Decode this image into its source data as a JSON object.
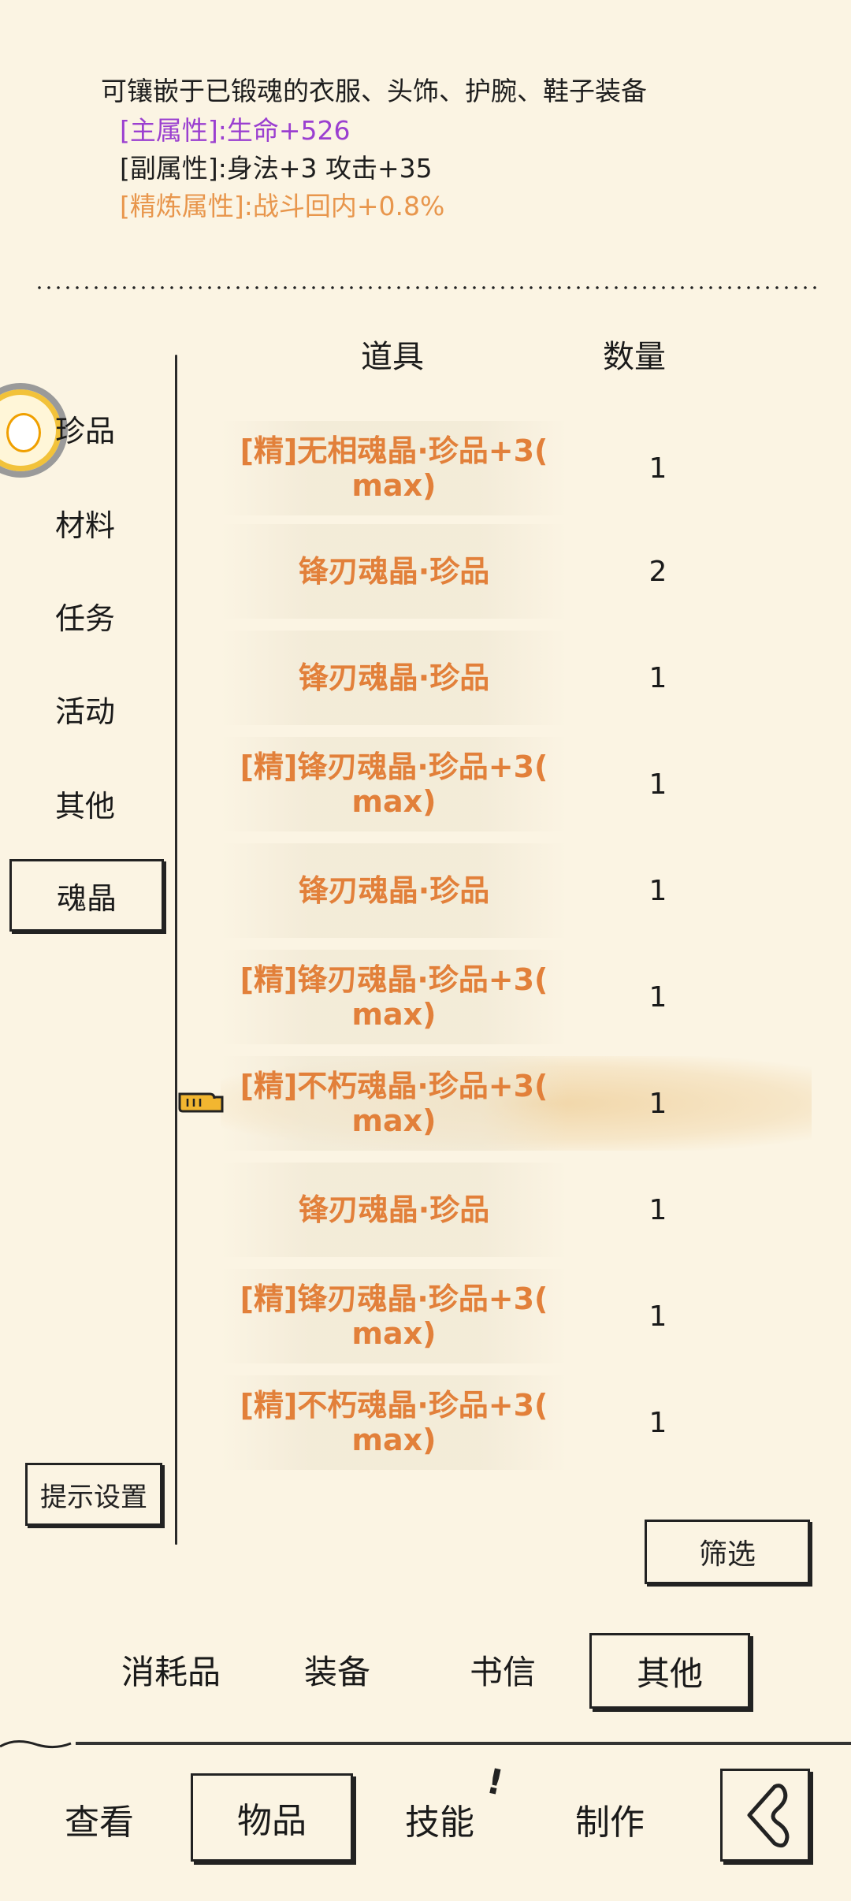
{
  "description": {
    "text": "可镶嵌于已锻魂的衣服、头饰、护腕、鞋子装备",
    "main_attr_label": "[主属性]",
    "main_attr_value": ":生命+526",
    "sub_attr_label": "[副属性]",
    "sub_attr_value": ":身法+3 攻击+35",
    "refine_attr_label": "[精炼属性]",
    "refine_attr_value": ":战斗回内+0.8%"
  },
  "categories": [
    {
      "label": "珍品"
    },
    {
      "label": "材料"
    },
    {
      "label": "任务"
    },
    {
      "label": "活动"
    },
    {
      "label": "其他"
    },
    {
      "label": "魂晶",
      "selected": true
    }
  ],
  "hint_settings_label": "提示设置",
  "table": {
    "col_item": "道具",
    "col_qty": "数量",
    "rows": [
      {
        "name_line1": "[精]无相魂晶·珍品+3(",
        "name_line2": "max)",
        "qty": "1"
      },
      {
        "name_line1": "锋刃魂晶·珍品",
        "name_line2": "",
        "qty": "2"
      },
      {
        "name_line1": "锋刃魂晶·珍品",
        "name_line2": "",
        "qty": "1"
      },
      {
        "name_line1": "[精]锋刃魂晶·珍品+3(",
        "name_line2": "max)",
        "qty": "1"
      },
      {
        "name_line1": "锋刃魂晶·珍品",
        "name_line2": "",
        "qty": "1"
      },
      {
        "name_line1": "[精]锋刃魂晶·珍品+3(",
        "name_line2": "max)",
        "qty": "1"
      },
      {
        "name_line1": "[精]不朽魂晶·珍品+3(",
        "name_line2": "max)",
        "qty": "1",
        "selected": true
      },
      {
        "name_line1": "锋刃魂晶·珍品",
        "name_line2": "",
        "qty": "1"
      },
      {
        "name_line1": "[精]锋刃魂晶·珍品+3(",
        "name_line2": "max)",
        "qty": "1"
      },
      {
        "name_line1": "[精]不朽魂晶·珍品+3(",
        "name_line2": "max)",
        "qty": "1"
      }
    ]
  },
  "filter_label": "筛选",
  "bag_tabs": [
    {
      "label": "消耗品"
    },
    {
      "label": "装备"
    },
    {
      "label": "书信"
    },
    {
      "label": "其他",
      "selected": true
    }
  ],
  "bottom_nav": [
    {
      "label": "查看"
    },
    {
      "label": "物品",
      "selected": true
    },
    {
      "label": "技能"
    },
    {
      "label": "制作"
    }
  ],
  "notice_mark": "!",
  "colors": {
    "background": "#fbf4e3",
    "item_orange": "#e2803a",
    "main_attr_purple": "#9b3fd0",
    "refine_attr_orange": "#e8964c"
  },
  "icons": {
    "avatar": "chibi-avatar-icon",
    "cursor": "pointing-hand-cursor-icon",
    "back": "back-arrow-icon"
  }
}
